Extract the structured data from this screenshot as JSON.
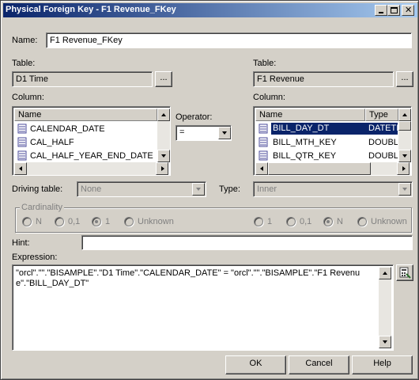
{
  "window": {
    "title": "Physical Foreign Key - F1 Revenue_FKey"
  },
  "name": {
    "label": "Name:",
    "value": "F1 Revenue_FKey"
  },
  "left": {
    "table_label": "Table:",
    "table_value": "D1 Time",
    "browse": "...",
    "column_label": "Column:",
    "header": "Name",
    "rows": [
      "CALENDAR_DATE",
      "CAL_HALF",
      "CAL_HALF_YEAR_END_DATE"
    ]
  },
  "operator": {
    "label": "Operator:",
    "value": "="
  },
  "right": {
    "table_label": "Table:",
    "table_value": "F1 Revenue",
    "browse": "...",
    "column_label": "Column:",
    "header_name": "Name",
    "header_type": "Type",
    "rows": [
      {
        "name": "BILL_DAY_DT",
        "type": "DATETIM"
      },
      {
        "name": "BILL_MTH_KEY",
        "type": "DOUBLE"
      },
      {
        "name": "BILL_QTR_KEY",
        "type": "DOUBLE"
      }
    ]
  },
  "driving": {
    "label": "Driving table:",
    "value": "None"
  },
  "type": {
    "label": "Type:",
    "value": "Inner"
  },
  "cardinality": {
    "label": "Cardinality",
    "left": [
      "N",
      "0,1",
      "1",
      "Unknown"
    ],
    "left_selected": "1",
    "right": [
      "1",
      "0,1",
      "N",
      "Unknown"
    ],
    "right_selected": "N"
  },
  "hint": {
    "label": "Hint:",
    "value": ""
  },
  "expression": {
    "label": "Expression:",
    "value": "\"orcl\".\"\".\"BISAMPLE\".\"D1 Time\".\"CALENDAR_DATE\" = \"orcl\".\"\".\"BISAMPLE\".\"F1 Revenue\".\"BILL_DAY_DT\""
  },
  "buttons": {
    "ok": "OK",
    "cancel": "Cancel",
    "help": "Help"
  },
  "colors": {
    "title_start": "#0a246a",
    "title_end": "#a6caf0",
    "selection": "#0a246a",
    "face": "#d4d0c8"
  },
  "icons": [
    "column-icon",
    "expression-builder-icon",
    "minimize-icon",
    "maximize-icon",
    "close-icon"
  ]
}
